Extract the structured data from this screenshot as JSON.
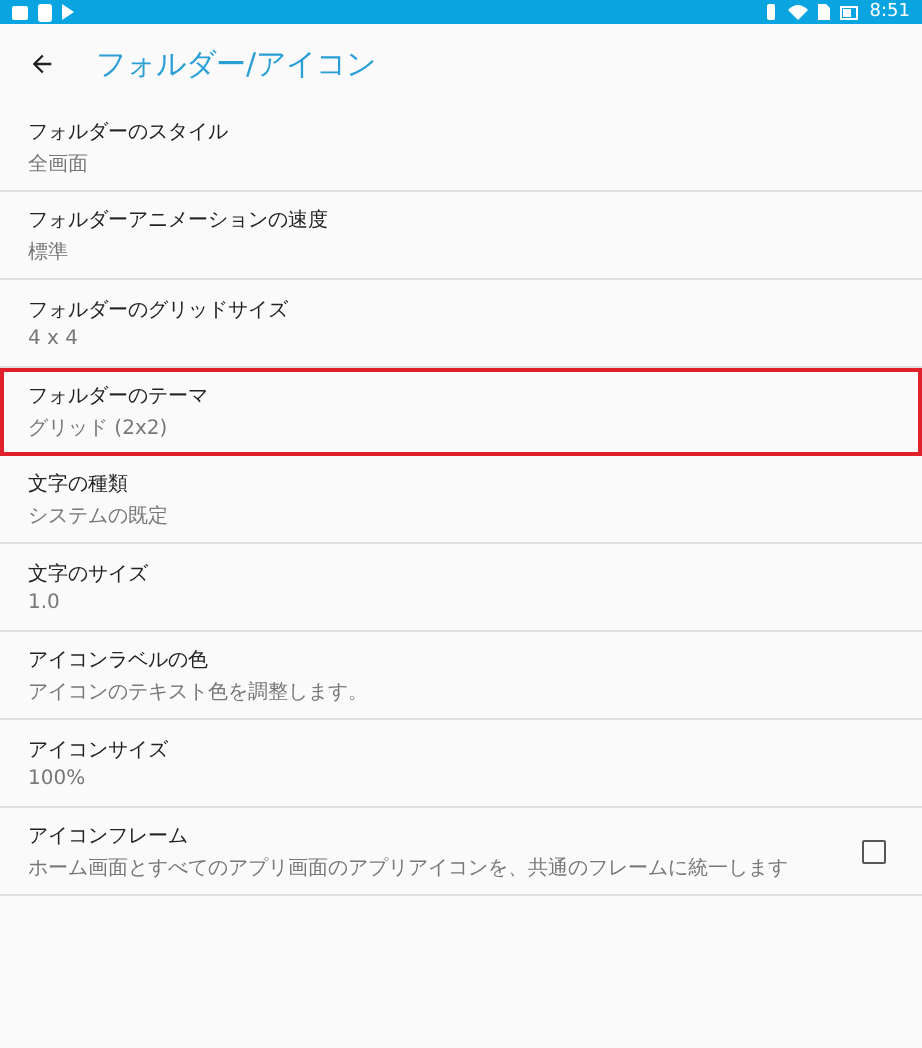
{
  "status_bar": {
    "time": "8:51"
  },
  "app_bar": {
    "title": "フォルダー/アイコン"
  },
  "settings": [
    {
      "kind": "plain",
      "title": "フォルダーのスタイル",
      "summary": "全画面",
      "highlighted": false
    },
    {
      "kind": "plain",
      "title": "フォルダーアニメーションの速度",
      "summary": "標準",
      "highlighted": false
    },
    {
      "kind": "plain",
      "title": "フォルダーのグリッドサイズ",
      "summary": "4 x 4",
      "highlighted": false
    },
    {
      "kind": "plain",
      "title": "フォルダーのテーマ",
      "summary": "グリッド (2x2)",
      "highlighted": true
    },
    {
      "kind": "plain",
      "title": "文字の種類",
      "summary": "システムの既定",
      "highlighted": false
    },
    {
      "kind": "plain",
      "title": "文字のサイズ",
      "summary": "1.0",
      "highlighted": false
    },
    {
      "kind": "plain",
      "title": "アイコンラベルの色",
      "summary": "アイコンのテキスト色を調整します。",
      "highlighted": false
    },
    {
      "kind": "plain",
      "title": "アイコンサイズ",
      "summary": "100%",
      "highlighted": false
    },
    {
      "kind": "checkbox",
      "title": "アイコンフレーム",
      "summary": "ホーム画面とすべてのアプリ画面のアプリアイコンを、共通のフレームに統一します",
      "highlighted": false,
      "checked": false
    }
  ]
}
